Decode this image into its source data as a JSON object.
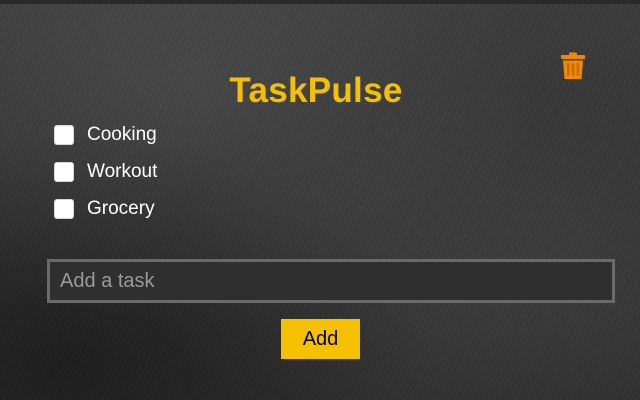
{
  "app": {
    "title": "TaskPulse"
  },
  "header": {
    "delete_icon": "trash-icon"
  },
  "tasks": [
    {
      "label": "Cooking",
      "checked": false
    },
    {
      "label": "Workout",
      "checked": false
    },
    {
      "label": "Grocery",
      "checked": false
    }
  ],
  "new_task": {
    "value": "",
    "placeholder": "Add a task"
  },
  "add_button": {
    "label": "Add"
  },
  "colors": {
    "accent": "#f5c000",
    "trash": "#f08a00",
    "background": "#363636",
    "text": "#ffffff"
  }
}
